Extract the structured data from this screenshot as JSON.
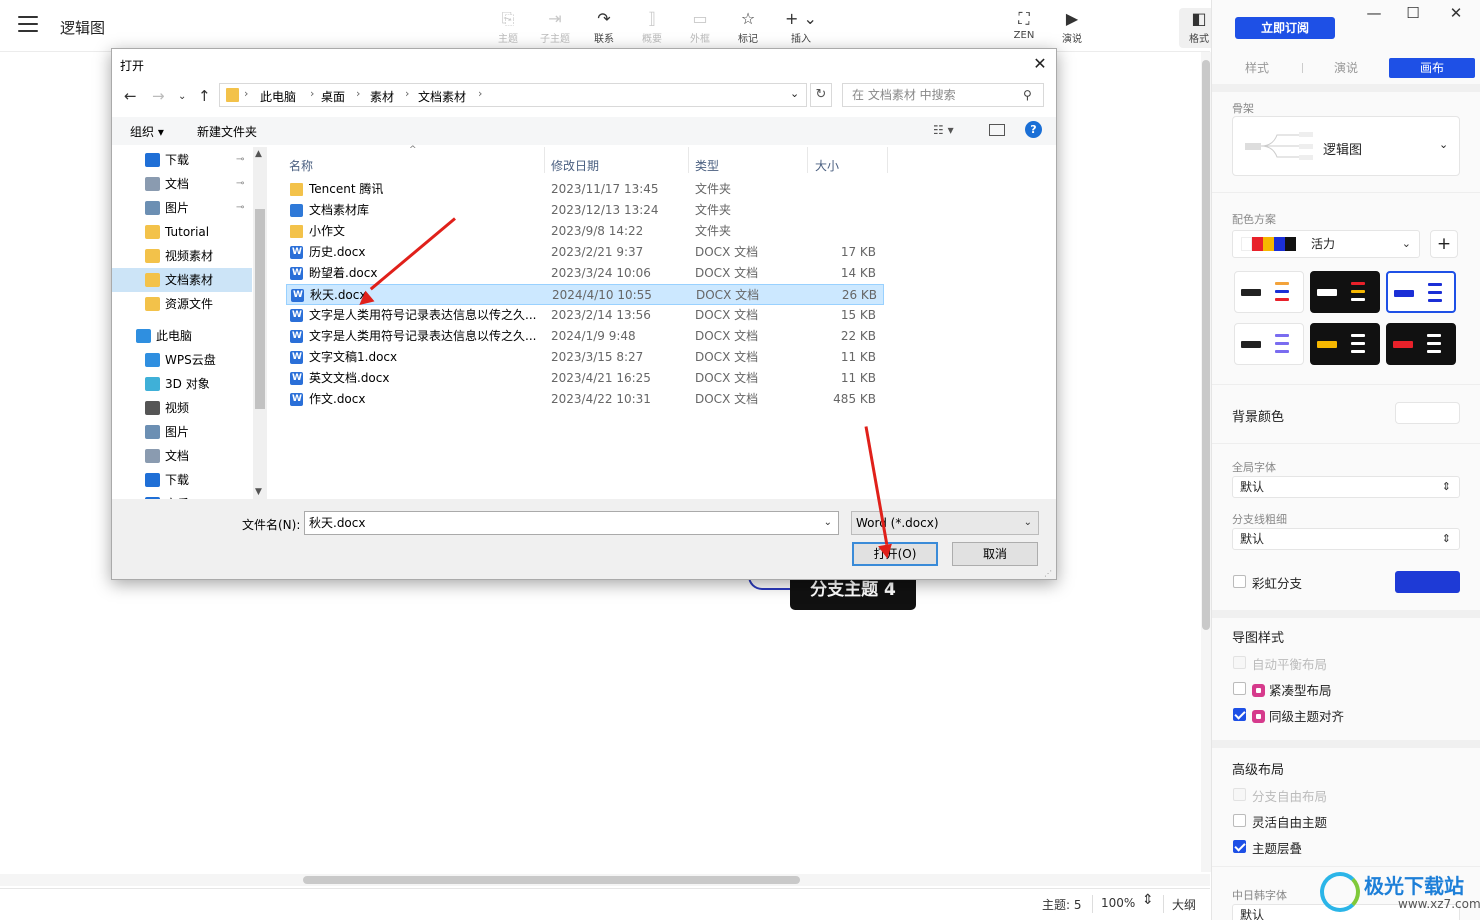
{
  "app": {
    "title": "逻辑图"
  },
  "toolbar": [
    {
      "label": "主题",
      "icon": "topic-icon",
      "disabled": true
    },
    {
      "label": "子主题",
      "icon": "subtopic-icon",
      "disabled": true
    },
    {
      "label": "联系",
      "icon": "relation-icon",
      "disabled": false
    },
    {
      "label": "概要",
      "icon": "summary-icon",
      "disabled": true
    },
    {
      "label": "外框",
      "icon": "boundary-icon",
      "disabled": true
    },
    {
      "label": "标记",
      "icon": "star-icon",
      "disabled": false
    },
    {
      "label": "插入",
      "icon": "plus-icon",
      "disabled": false
    },
    {
      "label": "ZEN",
      "icon": "fullscreen-icon",
      "disabled": false
    },
    {
      "label": "演说",
      "icon": "present-icon",
      "disabled": false
    },
    {
      "label": "格式",
      "icon": "format-panel-icon",
      "disabled": false
    }
  ],
  "canvas": {
    "node_label": "分支主题 4"
  },
  "status": {
    "topic_count": "主题: 5",
    "zoom": "100%",
    "outline": "大纲"
  },
  "right_panel": {
    "subscribe_label": "立即订阅",
    "tabs": [
      "样式",
      "演说",
      "画布"
    ],
    "active_tab": "画布",
    "skeleton_label": "骨架",
    "skeleton_value": "逻辑图",
    "color_scheme_label": "配色方案",
    "color_scheme_value": "活力",
    "color_scheme_swatches": [
      "#ffffff",
      "#e8212a",
      "#f6b700",
      "#1b2fd6",
      "#111111"
    ],
    "bg_color_label": "背景颜色",
    "global_font_label": "全局字体",
    "global_font_value": "默认",
    "branch_width_label": "分支线粗细",
    "branch_width_value": "默认",
    "rainbow_label": "彩虹分支",
    "rainbow_color": "#1e3ad6",
    "map_style_title": "导图样式",
    "map_style_options": [
      {
        "label": "自动平衡布局",
        "checked": false,
        "disabled": true,
        "locked": false
      },
      {
        "label": "紧凑型布局",
        "checked": false,
        "disabled": false,
        "locked": true
      },
      {
        "label": "同级主题对齐",
        "checked": true,
        "disabled": false,
        "locked": true
      }
    ],
    "adv_layout_title": "高级布局",
    "adv_layout_options": [
      {
        "label": "分支自由布局",
        "checked": false,
        "disabled": true
      },
      {
        "label": "灵活自由主题",
        "checked": false,
        "disabled": false
      },
      {
        "label": "主题层叠",
        "checked": true,
        "disabled": false
      }
    ],
    "cjk_font_label": "中日韩字体",
    "cjk_font_value": "默认"
  },
  "dialog": {
    "title": "打开",
    "breadcrumbs": [
      "此电脑",
      "桌面",
      "素材",
      "文档素材"
    ],
    "search_placeholder": "在 文档素材 中搜索",
    "organize_label": "组织 ▾",
    "new_folder_label": "新建文件夹",
    "nav_items": [
      {
        "label": "下载",
        "icon": "download-icon",
        "pinned": true,
        "indent": 1
      },
      {
        "label": "文档",
        "icon": "document-icon",
        "pinned": true,
        "indent": 1
      },
      {
        "label": "图片",
        "icon": "picture-icon",
        "pinned": true,
        "indent": 1
      },
      {
        "label": "Tutorial",
        "icon": "folder-icon",
        "pinned": false,
        "indent": 1
      },
      {
        "label": "视频素材",
        "icon": "folder-icon",
        "pinned": false,
        "indent": 1
      },
      {
        "label": "文档素材",
        "icon": "folder-icon",
        "pinned": false,
        "indent": 1,
        "active": true
      },
      {
        "label": "资源文件",
        "icon": "folder-icon",
        "pinned": false,
        "indent": 1
      },
      {
        "label": "此电脑",
        "icon": "computer-icon",
        "pinned": false,
        "indent": 0
      },
      {
        "label": "WPS云盘",
        "icon": "cloud-icon",
        "pinned": false,
        "indent": 1
      },
      {
        "label": "3D 对象",
        "icon": "cube-icon",
        "pinned": false,
        "indent": 1
      },
      {
        "label": "视频",
        "icon": "video-icon",
        "pinned": false,
        "indent": 1
      },
      {
        "label": "图片",
        "icon": "picture-icon",
        "pinned": false,
        "indent": 1
      },
      {
        "label": "文档",
        "icon": "document-icon",
        "pinned": false,
        "indent": 1
      },
      {
        "label": "下载",
        "icon": "download-icon",
        "pinned": false,
        "indent": 1
      },
      {
        "label": "音乐",
        "icon": "music-icon",
        "pinned": false,
        "indent": 1
      }
    ],
    "columns": [
      "名称",
      "修改日期",
      "类型",
      "大小"
    ],
    "files": [
      {
        "name": "Tencent 腾讯",
        "date": "2023/11/17 13:45",
        "type": "文件夹",
        "size": "",
        "kind": "folder"
      },
      {
        "name": "文档素材库",
        "date": "2023/12/13 13:24",
        "type": "文件夹",
        "size": "",
        "kind": "lib"
      },
      {
        "name": "小作文",
        "date": "2023/9/8 14:22",
        "type": "文件夹",
        "size": "",
        "kind": "folder"
      },
      {
        "name": "历史.docx",
        "date": "2023/2/21 9:37",
        "type": "DOCX 文档",
        "size": "17 KB",
        "kind": "doc"
      },
      {
        "name": "盼望着.docx",
        "date": "2023/3/24 10:06",
        "type": "DOCX 文档",
        "size": "14 KB",
        "kind": "doc"
      },
      {
        "name": "秋天.docx",
        "date": "2024/4/10 10:55",
        "type": "DOCX 文档",
        "size": "26 KB",
        "kind": "doc",
        "selected": true
      },
      {
        "name": "文字是人类用符号记录表达信息以传之久...",
        "date": "2023/2/14 13:56",
        "type": "DOCX 文档",
        "size": "15 KB",
        "kind": "doc"
      },
      {
        "name": "文字是人类用符号记录表达信息以传之久...",
        "date": "2024/1/9 9:48",
        "type": "DOCX 文档",
        "size": "22 KB",
        "kind": "doc"
      },
      {
        "name": "文字文稿1.docx",
        "date": "2023/3/15 8:27",
        "type": "DOCX 文档",
        "size": "11 KB",
        "kind": "doc"
      },
      {
        "name": "英文文档.docx",
        "date": "2023/4/21 16:25",
        "type": "DOCX 文档",
        "size": "11 KB",
        "kind": "doc"
      },
      {
        "name": "作文.docx",
        "date": "2023/4/22 10:31",
        "type": "DOCX 文档",
        "size": "485 KB",
        "kind": "doc"
      }
    ],
    "filename_label": "文件名(N):",
    "filename_value": "秋天.docx",
    "filetype_value": "Word (*.docx)",
    "open_label": "打开(O)",
    "cancel_label": "取消"
  },
  "watermark": {
    "text": "极光下载站",
    "url": "www.xz7.com"
  }
}
